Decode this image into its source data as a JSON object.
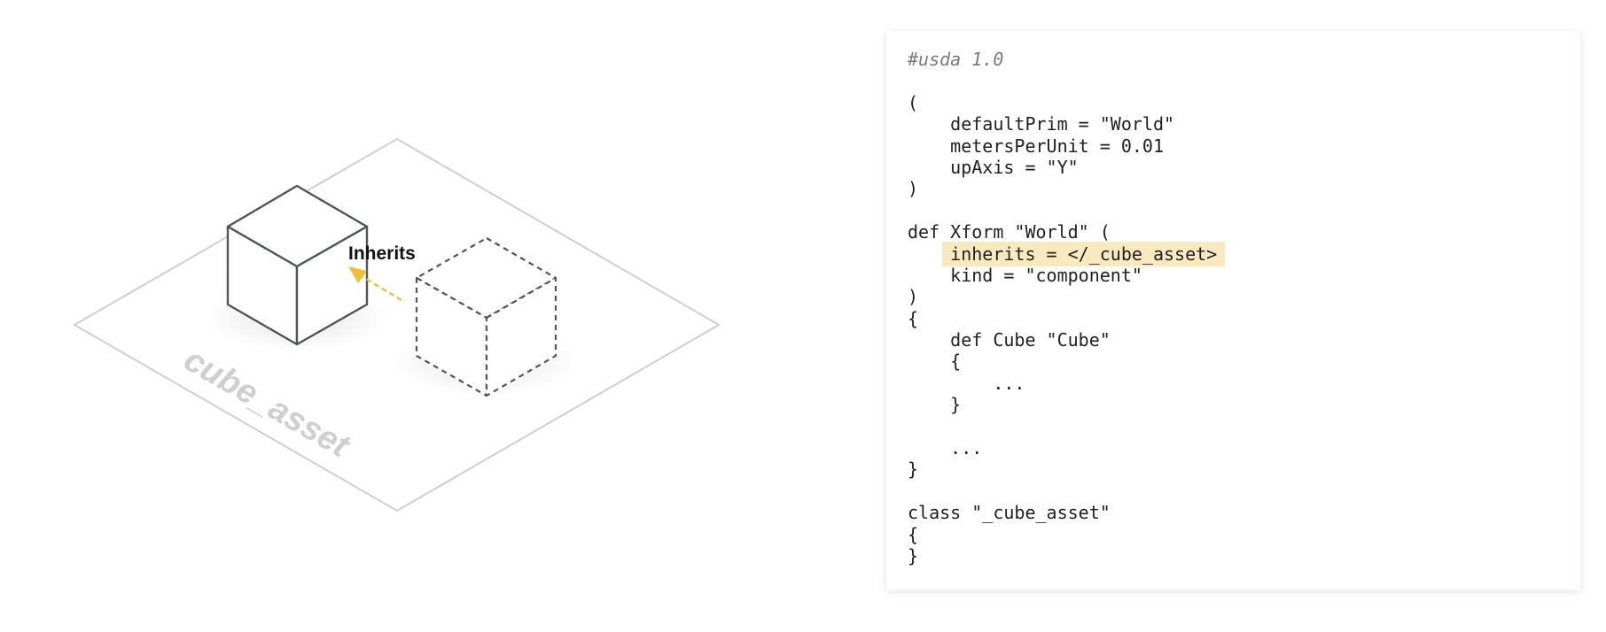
{
  "diagram": {
    "plane_label": "cube_asset",
    "arrow_label": "Inherits",
    "colors": {
      "plane_stroke": "#cfcfcf",
      "plane_label": "#cfcfcf",
      "cube_stroke": "#505654",
      "dashed_cube_stroke": "#555555",
      "arrow": "#f0bf3a"
    }
  },
  "code": {
    "highlight_color": "#f9e9be",
    "lines": [
      {
        "text": "#usda 1.0",
        "style": "comment"
      },
      {
        "text": "",
        "style": "normal"
      },
      {
        "text": "(",
        "style": "normal"
      },
      {
        "text": "    defaultPrim = \"World\"",
        "style": "normal"
      },
      {
        "text": "    metersPerUnit = 0.01",
        "style": "normal"
      },
      {
        "text": "    upAxis = \"Y\"",
        "style": "normal"
      },
      {
        "text": ")",
        "style": "normal"
      },
      {
        "text": "",
        "style": "normal"
      },
      {
        "text": "def Xform \"World\" (",
        "style": "normal"
      },
      {
        "text": "inherits = </_cube_asset>",
        "indent": "    ",
        "style": "highlight"
      },
      {
        "text": "    kind = \"component\"",
        "style": "normal"
      },
      {
        "text": ")",
        "style": "normal"
      },
      {
        "text": "{",
        "style": "normal"
      },
      {
        "text": "    def Cube \"Cube\"",
        "style": "normal"
      },
      {
        "text": "    {",
        "style": "normal"
      },
      {
        "text": "        ...",
        "style": "normal"
      },
      {
        "text": "    }",
        "style": "normal"
      },
      {
        "text": "",
        "style": "normal"
      },
      {
        "text": "    ...",
        "style": "normal"
      },
      {
        "text": "}",
        "style": "normal"
      },
      {
        "text": "",
        "style": "normal"
      },
      {
        "text": "class \"_cube_asset\"",
        "style": "normal"
      },
      {
        "text": "{",
        "style": "normal"
      },
      {
        "text": "}",
        "style": "normal"
      }
    ]
  }
}
